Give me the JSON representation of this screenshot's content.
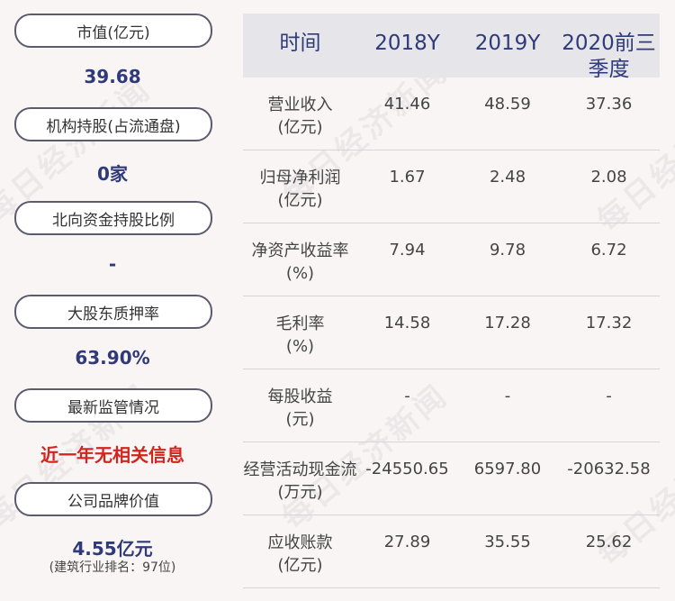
{
  "left": {
    "items": [
      {
        "label": "市值(亿元)",
        "value": "39.68"
      },
      {
        "label": "机构持股(占流通盘)",
        "value": "0家"
      },
      {
        "label": "北向资金持股比例",
        "value": "-"
      },
      {
        "label": "大股东质押率",
        "value": "63.90%"
      },
      {
        "label": "最新监管情况",
        "value": "近一年无相关信息"
      },
      {
        "label": "公司品牌价值",
        "value": "4.55亿元",
        "note": "(建筑行业排名：97位)"
      }
    ]
  },
  "table": {
    "headers": [
      "时间",
      "2018Y",
      "2019Y",
      "2020前三季度"
    ],
    "rows": [
      {
        "label": "营业收入",
        "unit": "(亿元)",
        "values": [
          "41.46",
          "48.59",
          "37.36"
        ]
      },
      {
        "label": "归母净利润",
        "unit": "(亿元)",
        "values": [
          "1.67",
          "2.48",
          "2.08"
        ]
      },
      {
        "label": "净资产收益率",
        "unit": "(%)",
        "values": [
          "7.94",
          "9.78",
          "6.72"
        ]
      },
      {
        "label": "毛利率",
        "unit": "(%)",
        "values": [
          "14.58",
          "17.28",
          "17.32"
        ]
      },
      {
        "label": "每股收益",
        "unit": "(元)",
        "values": [
          "-",
          "-",
          "-"
        ]
      },
      {
        "label": "经营活动现金流",
        "unit": "(万元)",
        "values": [
          "-24550.65",
          "6597.80",
          "-20632.58"
        ]
      },
      {
        "label": "应收账款",
        "unit": "(亿元)",
        "values": [
          "27.89",
          "35.55",
          "25.62"
        ]
      }
    ]
  },
  "watermark": "每日经济新闻",
  "colors": {
    "accent": "#2f3a7a",
    "alert": "#d1261f",
    "header_bg": "#e6e6ea"
  }
}
